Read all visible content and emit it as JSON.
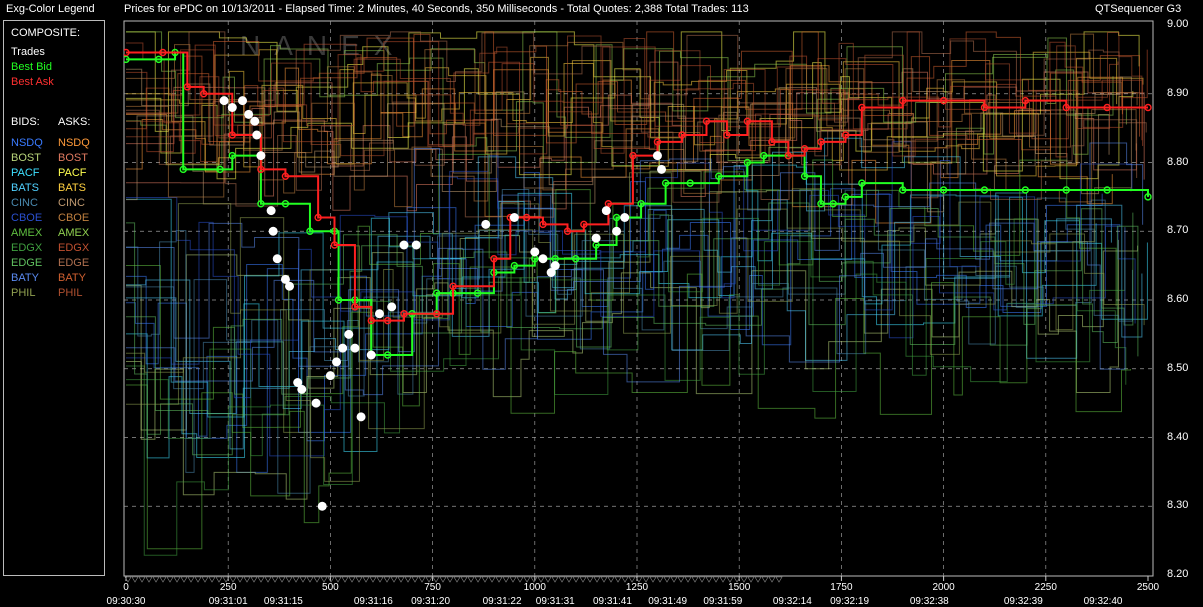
{
  "header": {
    "legend_title": "Exg-Color Legend",
    "chart_title": "Prices for  ePDC  on  10/13/2011  -  Elapsed Time: 2 Minutes, 40 Seconds, 350 Milliseconds  -  Total Quotes: 2,388  Total Trades: 113",
    "app_name": "QTSequencer G3"
  },
  "legend": {
    "composite_label": "COMPOSITE:",
    "trades_label": "Trades",
    "best_bid_label": "Best Bid",
    "best_ask_label": "Best Ask",
    "bids_label": "BIDS:",
    "asks_label": "ASKS:",
    "exchanges": [
      {
        "name": "NSDQ",
        "bid_color": "#3a7bff",
        "ask_color": "#ff9a3a"
      },
      {
        "name": "BOST",
        "bid_color": "#b8d47a",
        "ask_color": "#e07a60"
      },
      {
        "name": "PACF",
        "bid_color": "#3ee0ff",
        "ask_color": "#ffff50"
      },
      {
        "name": "BATS",
        "bid_color": "#50d0ff",
        "ask_color": "#ffd040"
      },
      {
        "name": "CINC",
        "bid_color": "#4a8ab0",
        "ask_color": "#c09a70"
      },
      {
        "name": "CBOE",
        "bid_color": "#2a50d0",
        "ask_color": "#c08040"
      },
      {
        "name": "AMEX",
        "bid_color": "#60c040",
        "ask_color": "#90d050"
      },
      {
        "name": "EDGX",
        "bid_color": "#40a040",
        "ask_color": "#c05030"
      },
      {
        "name": "EDGE",
        "bid_color": "#60c060",
        "ask_color": "#b07050"
      },
      {
        "name": "BATY",
        "bid_color": "#5a8af0",
        "ask_color": "#d06030"
      },
      {
        "name": "PHIL",
        "bid_color": "#90a050",
        "ask_color": "#b05030"
      }
    ]
  },
  "colors": {
    "trade_dot": "#ffffff",
    "best_bid": "#22ff22",
    "best_ask": "#ff2020",
    "grid": "#9a9a9a"
  },
  "chart_data": {
    "type": "line",
    "title": "",
    "ylim": [
      8.2,
      9.0
    ],
    "y_ticks": [
      "9.00",
      "8.90",
      "8.80",
      "8.70",
      "8.60",
      "8.50",
      "8.40",
      "8.30",
      "8.20"
    ],
    "xlim": [
      0,
      2500
    ],
    "x_ticks": [
      "0",
      "250",
      "500",
      "750",
      "1000",
      "1250",
      "1500",
      "1750",
      "2000",
      "2250",
      "2500"
    ],
    "x_time_labels": [
      {
        "at": 0,
        "label": "09:30:30"
      },
      {
        "at": 250,
        "label": "09:31:01"
      },
      {
        "at": 385,
        "label": "09:31:15"
      },
      {
        "at": 605,
        "label": "09:31:16"
      },
      {
        "at": 745,
        "label": "09:31:20"
      },
      {
        "at": 920,
        "label": "09:31:22"
      },
      {
        "at": 1050,
        "label": "09:31:31"
      },
      {
        "at": 1190,
        "label": "09:31:41"
      },
      {
        "at": 1325,
        "label": "09:31:49"
      },
      {
        "at": 1460,
        "label": "09:31:59"
      },
      {
        "at": 1630,
        "label": "09:32:14"
      },
      {
        "at": 1770,
        "label": "09:32:19"
      },
      {
        "at": 1965,
        "label": "09:32:38"
      },
      {
        "at": 2195,
        "label": "09:32:39"
      },
      {
        "at": 2390,
        "label": "09:32:40"
      }
    ],
    "series": [
      {
        "name": "Best Bid",
        "color": "#22ff22",
        "x": [
          0,
          80,
          120,
          140,
          230,
          260,
          330,
          390,
          450,
          510,
          520,
          560,
          600,
          640,
          700,
          760,
          800,
          860,
          900,
          950,
          1000,
          1050,
          1100,
          1150,
          1200,
          1260,
          1320,
          1380,
          1450,
          1520,
          1560,
          1620,
          1660,
          1700,
          1730,
          1760,
          1800,
          1900,
          2000,
          2100,
          2200,
          2300,
          2400,
          2500
        ],
        "y": [
          8.95,
          8.95,
          8.96,
          8.79,
          8.79,
          8.81,
          8.74,
          8.74,
          8.7,
          8.7,
          8.6,
          8.6,
          8.52,
          8.52,
          8.58,
          8.61,
          8.61,
          8.61,
          8.64,
          8.65,
          8.66,
          8.66,
          8.66,
          8.68,
          8.72,
          8.74,
          8.77,
          8.77,
          8.78,
          8.8,
          8.81,
          8.81,
          8.78,
          8.74,
          8.74,
          8.75,
          8.77,
          8.76,
          8.76,
          8.76,
          8.76,
          8.76,
          8.76,
          8.75
        ]
      },
      {
        "name": "Best Ask",
        "color": "#ff2020",
        "x": [
          0,
          90,
          150,
          190,
          260,
          330,
          390,
          470,
          510,
          560,
          600,
          640,
          680,
          760,
          800,
          900,
          940,
          980,
          1020,
          1080,
          1120,
          1180,
          1240,
          1300,
          1360,
          1420,
          1470,
          1520,
          1580,
          1620,
          1660,
          1700,
          1760,
          1800,
          1900,
          2000,
          2100,
          2200,
          2300,
          2400,
          2500
        ],
        "y": [
          8.96,
          8.96,
          8.91,
          8.9,
          8.84,
          8.79,
          8.78,
          8.72,
          8.68,
          8.59,
          8.57,
          8.57,
          8.58,
          8.58,
          8.62,
          8.66,
          8.72,
          8.72,
          8.71,
          8.7,
          8.71,
          8.74,
          8.81,
          8.83,
          8.84,
          8.86,
          8.84,
          8.86,
          8.83,
          8.81,
          8.82,
          8.83,
          8.84,
          8.88,
          8.89,
          8.89,
          8.88,
          8.89,
          8.88,
          8.88,
          8.88
        ]
      }
    ],
    "trades": [
      {
        "x": 240,
        "y": 8.89
      },
      {
        "x": 260,
        "y": 8.88
      },
      {
        "x": 285,
        "y": 8.89
      },
      {
        "x": 300,
        "y": 8.87
      },
      {
        "x": 315,
        "y": 8.86
      },
      {
        "x": 320,
        "y": 8.84
      },
      {
        "x": 330,
        "y": 8.81
      },
      {
        "x": 355,
        "y": 8.73
      },
      {
        "x": 360,
        "y": 8.7
      },
      {
        "x": 370,
        "y": 8.66
      },
      {
        "x": 390,
        "y": 8.63
      },
      {
        "x": 400,
        "y": 8.62
      },
      {
        "x": 420,
        "y": 8.48
      },
      {
        "x": 430,
        "y": 8.47
      },
      {
        "x": 465,
        "y": 8.45
      },
      {
        "x": 480,
        "y": 8.3
      },
      {
        "x": 500,
        "y": 8.49
      },
      {
        "x": 515,
        "y": 8.51
      },
      {
        "x": 530,
        "y": 8.53
      },
      {
        "x": 545,
        "y": 8.55
      },
      {
        "x": 560,
        "y": 8.53
      },
      {
        "x": 575,
        "y": 8.43
      },
      {
        "x": 600,
        "y": 8.52
      },
      {
        "x": 620,
        "y": 8.58
      },
      {
        "x": 650,
        "y": 8.59
      },
      {
        "x": 680,
        "y": 8.68
      },
      {
        "x": 710,
        "y": 8.68
      },
      {
        "x": 880,
        "y": 8.71
      },
      {
        "x": 950,
        "y": 8.72
      },
      {
        "x": 1000,
        "y": 8.67
      },
      {
        "x": 1020,
        "y": 8.66
      },
      {
        "x": 1040,
        "y": 8.64
      },
      {
        "x": 1050,
        "y": 8.65
      },
      {
        "x": 1150,
        "y": 8.69
      },
      {
        "x": 1175,
        "y": 8.73
      },
      {
        "x": 1200,
        "y": 8.7
      },
      {
        "x": 1220,
        "y": 8.72
      },
      {
        "x": 1300,
        "y": 8.81
      },
      {
        "x": 1310,
        "y": 8.79
      }
    ]
  }
}
